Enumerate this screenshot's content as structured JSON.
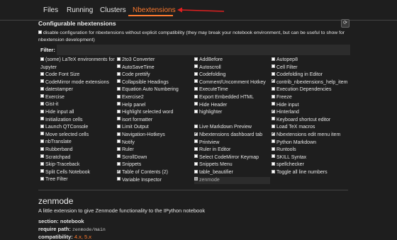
{
  "tabs": [
    {
      "label": "Files"
    },
    {
      "label": "Running"
    },
    {
      "label": "Clusters"
    },
    {
      "label": "Nbextensions"
    }
  ],
  "accent_color": "#ff7a2e",
  "title": "Configurable nbextensions",
  "refresh_icon": "refresh-icon",
  "disable_text": "disable configuration for nbextensions without explicit compatibility (they may break your notebook environment, but can be useful to show for nbextension development)",
  "filter_label": "Filter:",
  "filter_value": "",
  "columns": [
    [
      {
        "label": "(some) LaTeX environments for Jupyter",
        "checked": false
      },
      {
        "label": "Code Font Size",
        "checked": false
      },
      {
        "label": "CodeMirror mode extensions",
        "checked": false
      },
      {
        "label": "datestamper",
        "checked": false
      },
      {
        "label": "Exercise",
        "checked": false
      },
      {
        "label": "Gist-it",
        "checked": false
      },
      {
        "label": "Hide input all",
        "checked": false
      },
      {
        "label": "Initialization cells",
        "checked": false
      },
      {
        "label": "Launch QTConsole",
        "checked": false
      },
      {
        "label": "Move selected cells",
        "checked": false
      },
      {
        "label": "nbTranslate",
        "checked": false
      },
      {
        "label": "Rubberband",
        "checked": false
      },
      {
        "label": "Scratchpad",
        "checked": false
      },
      {
        "label": "Skip-Traceback",
        "checked": false
      },
      {
        "label": "Split Cells Notebook",
        "checked": false
      },
      {
        "label": "Tree Filter",
        "checked": false
      }
    ],
    [
      {
        "label": "2to3 Converter",
        "checked": false
      },
      {
        "label": "AutoSaveTime",
        "checked": false
      },
      {
        "label": "Code prettify",
        "checked": false
      },
      {
        "label": "Collapsible Headings",
        "checked": false
      },
      {
        "label": "Equation Auto Numbering",
        "checked": false
      },
      {
        "label": "Exercise2",
        "checked": false
      },
      {
        "label": "Help panel",
        "checked": false
      },
      {
        "label": "Highlight selected word",
        "checked": false
      },
      {
        "label": "isort formatter",
        "checked": false
      },
      {
        "label": "Limit Output",
        "checked": false
      },
      {
        "label": "Navigation-Hotkeys",
        "checked": false
      },
      {
        "label": "Notify",
        "checked": false
      },
      {
        "label": "Ruler",
        "checked": false
      },
      {
        "label": "ScrollDown",
        "checked": false
      },
      {
        "label": "Snippets",
        "checked": false
      },
      {
        "label": "Table of Contents (2)",
        "checked": true
      },
      {
        "label": "Variable Inspector",
        "checked": false
      }
    ],
    [
      {
        "label": "AddBefore",
        "checked": false
      },
      {
        "label": "Autoscroll",
        "checked": false
      },
      {
        "label": "Codefolding",
        "checked": false
      },
      {
        "label": "Comment/Uncomment Hotkey",
        "checked": false
      },
      {
        "label": "ExecuteTime",
        "checked": false
      },
      {
        "label": "Export Embedded HTML",
        "checked": false
      },
      {
        "label": "Hide Header",
        "checked": false
      },
      {
        "label": "highlighter",
        "checked": false
      },
      {
        "label": "",
        "checked": null
      },
      {
        "label": "Live Markdown Preview",
        "checked": false
      },
      {
        "label": "Nbextensions dashboard tab",
        "checked": true
      },
      {
        "label": "Printview",
        "checked": false
      },
      {
        "label": "Ruler in Editor",
        "checked": false
      },
      {
        "label": "Select CodeMirror Keymap",
        "checked": false
      },
      {
        "label": "Snippets Menu",
        "checked": false
      },
      {
        "label": "table_beautifier",
        "checked": false
      },
      {
        "label": "zenmode",
        "checked": false,
        "selected": true
      }
    ],
    [
      {
        "label": "Autopep8",
        "checked": false
      },
      {
        "label": "Cell Filter",
        "checked": false
      },
      {
        "label": "Codefolding in Editor",
        "checked": false
      },
      {
        "label": "contrib_nbextensions_help_item",
        "checked": true
      },
      {
        "label": "Execution Dependencies",
        "checked": false
      },
      {
        "label": "Freeze",
        "checked": false
      },
      {
        "label": "Hide input",
        "checked": false
      },
      {
        "label": "Hinterland",
        "checked": true
      },
      {
        "label": "Keyboard shortcut editor",
        "checked": false
      },
      {
        "label": "Load TeX macros",
        "checked": false
      },
      {
        "label": "Nbextensions edit menu item",
        "checked": true
      },
      {
        "label": "Python Markdown",
        "checked": false
      },
      {
        "label": "Runtools",
        "checked": false
      },
      {
        "label": "SKILL Syntax",
        "checked": false
      },
      {
        "label": "spellchecker",
        "checked": false
      },
      {
        "label": "Toggle all line numbers",
        "checked": false
      }
    ]
  ],
  "detail": {
    "name": "zenmode",
    "description": "A little extension to give Zenmode functionality to the IPython notebook",
    "section_label": "section:",
    "section_value": "notebook",
    "path_label": "require path:",
    "path_value": "zenmode/main",
    "compat_label": "compatibility:",
    "compat_value": "4.x, 5.x"
  }
}
